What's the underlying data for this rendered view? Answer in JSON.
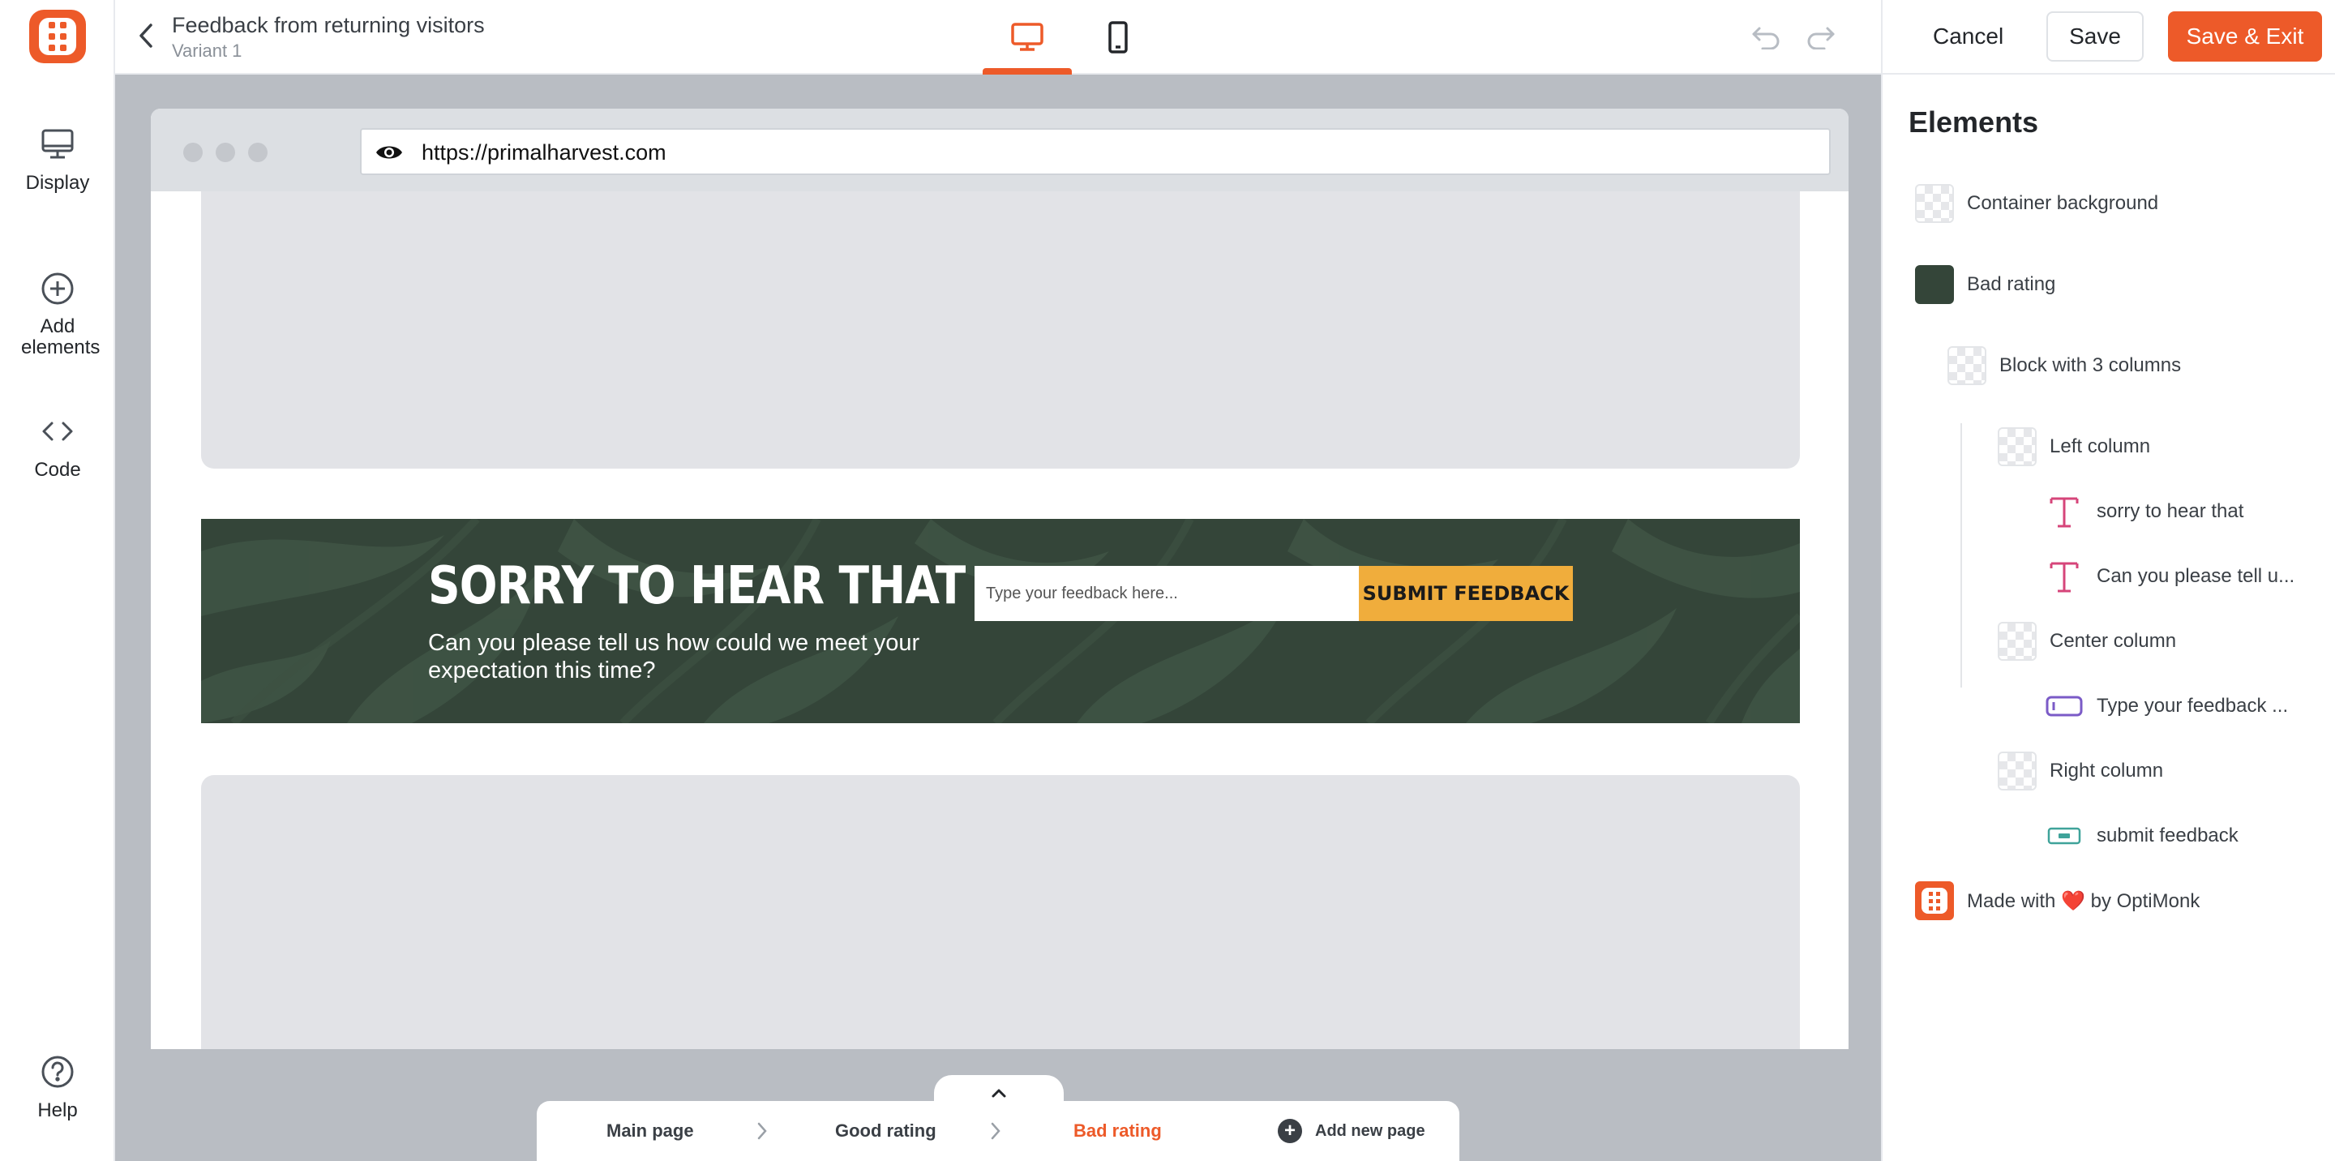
{
  "sidebar": {
    "items": [
      {
        "label": "Display",
        "icon": "monitor-icon"
      },
      {
        "label": "Add elements",
        "icon": "plus-circle-icon"
      },
      {
        "label": "Code",
        "icon": "code-icon"
      }
    ],
    "help_label": "Help"
  },
  "header": {
    "title": "Feedback from returning visitors",
    "subtitle": "Variant 1",
    "active_device": "desktop",
    "cancel_label": "Cancel",
    "save_label": "Save",
    "save_exit_label": "Save & Exit"
  },
  "colors": {
    "accent": "#ed5a29",
    "popup_bg": "#344539",
    "submit_bg": "#f0ad3c"
  },
  "browser": {
    "url": "https://primalharvest.com"
  },
  "popup": {
    "title": "SORRY TO HEAR THAT",
    "subtitle": "Can you please tell us how could we meet your expectation this time?",
    "input_placeholder": "Type your feedback here...",
    "submit_label": "SUBMIT FEEDBACK"
  },
  "pages": {
    "tabs": [
      {
        "label": "Main page",
        "active": false
      },
      {
        "label": "Good rating",
        "active": false
      },
      {
        "label": "Bad rating",
        "active": true
      }
    ],
    "add_label": "Add new page"
  },
  "elements_panel": {
    "title": "Elements",
    "items": [
      {
        "label": "Container background",
        "icon": "checker-thumb"
      },
      {
        "label": "Bad rating",
        "icon": "dark-thumb"
      },
      {
        "label": "Block with 3 columns",
        "icon": "checker-thumb"
      },
      {
        "label": "Left column",
        "icon": "checker-thumb"
      },
      {
        "label": "sorry to hear that",
        "icon": "text-icon"
      },
      {
        "label": "Can you please tell u...",
        "icon": "text-icon"
      },
      {
        "label": "Center column",
        "icon": "checker-thumb"
      },
      {
        "label": "Type your feedback ...",
        "icon": "input-icon"
      },
      {
        "label": "Right column",
        "icon": "checker-thumb"
      },
      {
        "label": "submit feedback",
        "icon": "button-icon"
      },
      {
        "label": "Made with ❤️ by OptiMonk",
        "icon": "optimonk-logo"
      }
    ]
  }
}
